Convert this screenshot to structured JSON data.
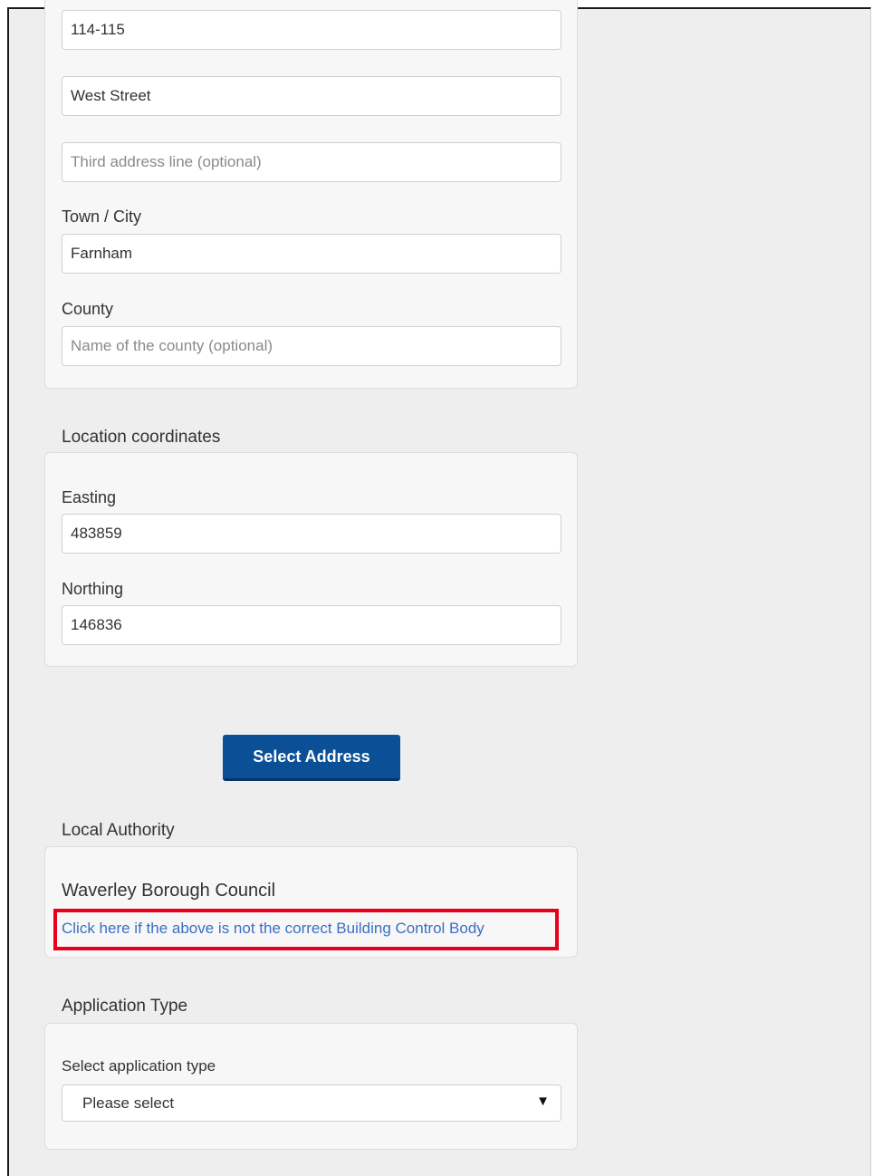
{
  "address": {
    "line1_value": "114-115",
    "line2_value": "West Street",
    "line3_placeholder": "Third address line (optional)",
    "town_label": "Town / City",
    "town_value": "Farnham",
    "county_label": "County",
    "county_placeholder": "Name of the county (optional)"
  },
  "coordinates": {
    "heading": "Location coordinates",
    "easting_label": "Easting",
    "easting_value": "483859",
    "northing_label": "Northing",
    "northing_value": "146836"
  },
  "select_address_button": "Select Address",
  "local_authority": {
    "heading": "Local Authority",
    "name": "Waverley Borough Council",
    "change_link": "Click here if the above is not the correct Building Control Body"
  },
  "application_type": {
    "heading": "Application Type",
    "select_label": "Select application type",
    "selected_value": "Please select"
  },
  "colors": {
    "primary_button": "#0b4f96",
    "link": "#3a6fc4",
    "highlight_box": "#e8001a"
  },
  "icons": {
    "dropdown": "triangle-down-icon"
  }
}
